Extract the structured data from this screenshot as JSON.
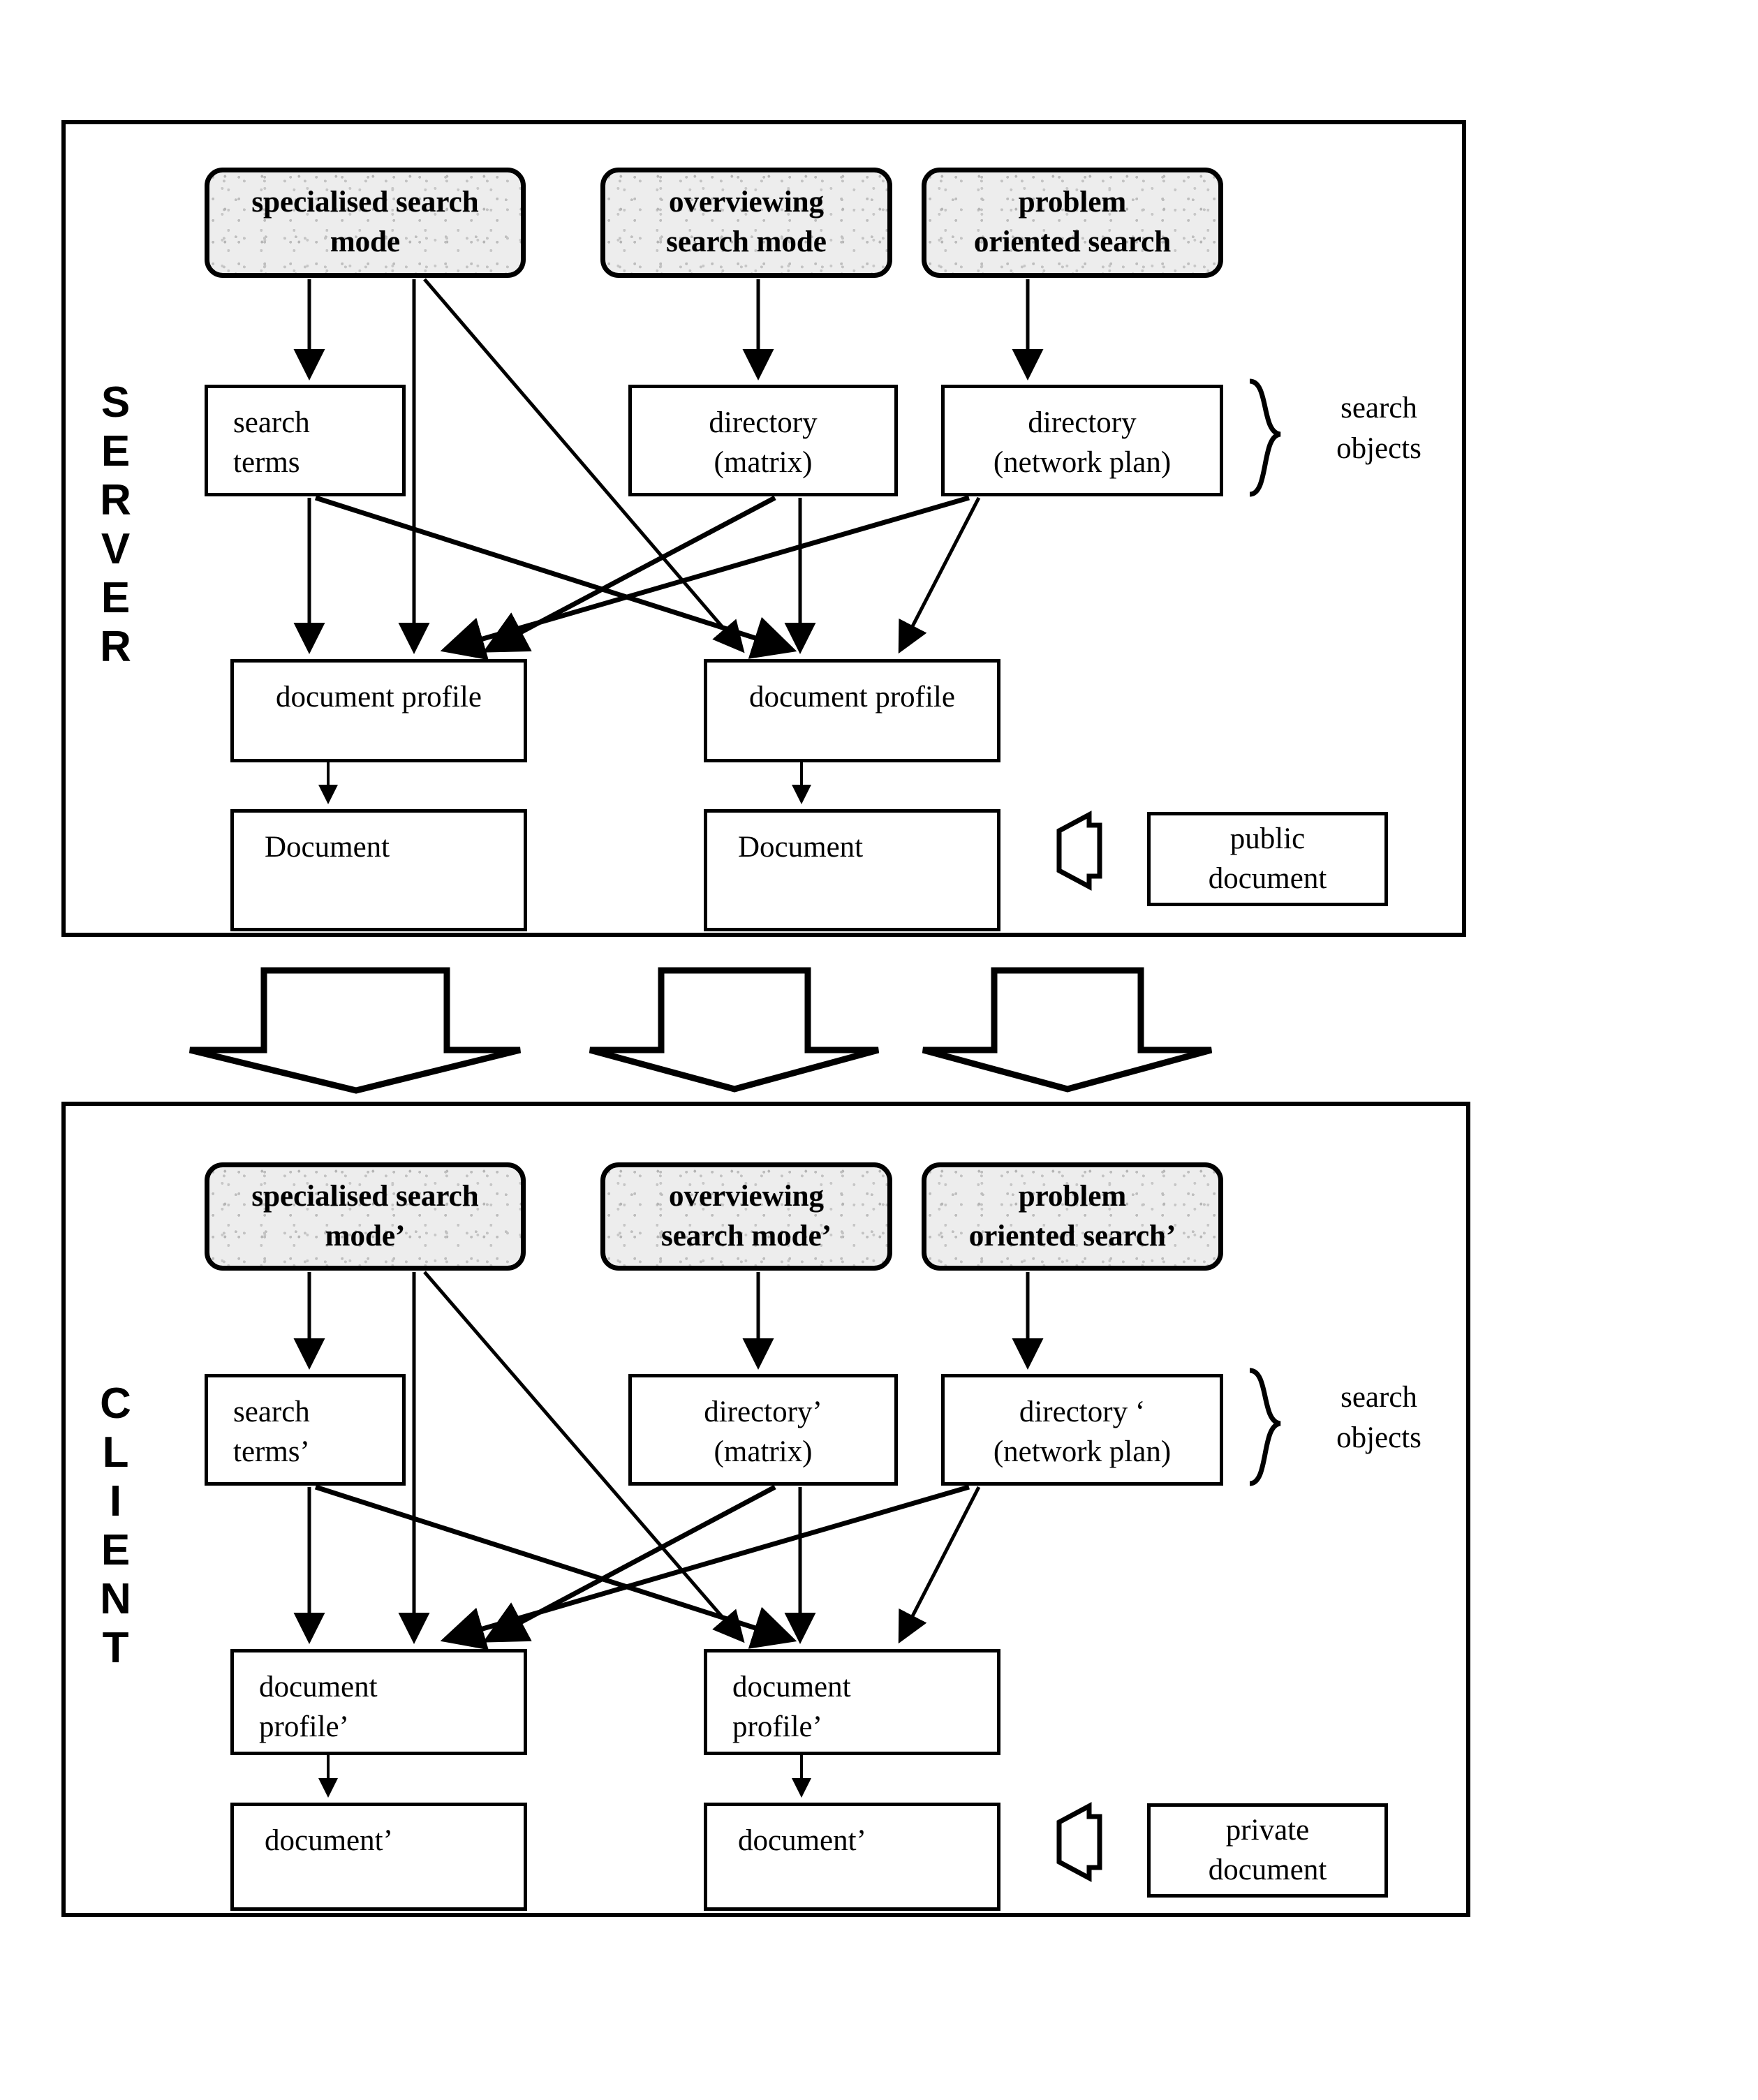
{
  "diagram": {
    "sections": [
      {
        "id": "server",
        "side_label": "SERVER",
        "modes": [
          {
            "id": "specialised-search-mode",
            "label": "specialised search\nmode"
          },
          {
            "id": "overviewing-search-mode",
            "label": "overviewing\nsearch mode"
          },
          {
            "id": "problem-oriented-search",
            "label": "problem\noriented search"
          }
        ],
        "objects": [
          {
            "id": "search-terms",
            "label": "search\nterms"
          },
          {
            "id": "directory-matrix",
            "label": "directory\n(matrix)"
          },
          {
            "id": "directory-network-plan",
            "label": "directory\n(network plan)"
          }
        ],
        "objects_brace_label": "search\nobjects",
        "profiles": [
          {
            "id": "document-profile-left",
            "label": "document profile"
          },
          {
            "id": "document-profile-right",
            "label": "document profile"
          }
        ],
        "documents": [
          {
            "id": "document-left",
            "label": "Document"
          },
          {
            "id": "document-right",
            "label": "Document"
          }
        ],
        "legend": {
          "id": "public-document",
          "label": "public\ndocument",
          "arrow": "left-arrow-icon"
        }
      },
      {
        "id": "client",
        "side_label": "CLIENT",
        "modes": [
          {
            "id": "specialised-search-mode-prime",
            "label": "specialised search\nmode’"
          },
          {
            "id": "overviewing-search-mode-prime",
            "label": "overviewing\nsearch mode’"
          },
          {
            "id": "problem-oriented-search-prime",
            "label": "problem\noriented search’"
          }
        ],
        "objects": [
          {
            "id": "search-terms-prime",
            "label": "search\nterms’"
          },
          {
            "id": "directory-matrix-prime",
            "label": "directory’\n(matrix)"
          },
          {
            "id": "directory-network-plan-prime",
            "label": "directory ‘\n(network plan)"
          }
        ],
        "objects_brace_label": "search\nobjects",
        "profiles": [
          {
            "id": "document-profile-prime-left",
            "label": "document\nprofile’"
          },
          {
            "id": "document-profile-prime-right",
            "label": "document\nprofile’"
          }
        ],
        "documents": [
          {
            "id": "document-prime-left",
            "label": "document’"
          },
          {
            "id": "document-prime-right",
            "label": "document’"
          }
        ],
        "legend": {
          "id": "private-document",
          "label": "private\ndocument",
          "arrow": "left-arrow-icon"
        }
      }
    ],
    "transfer_arrows": {
      "count": 3,
      "direction": "down",
      "name": "server-to-client-arrow"
    },
    "colors": {
      "stroke": "#000000",
      "fill": "#ffffff",
      "mode_fill": "#ededed"
    }
  }
}
